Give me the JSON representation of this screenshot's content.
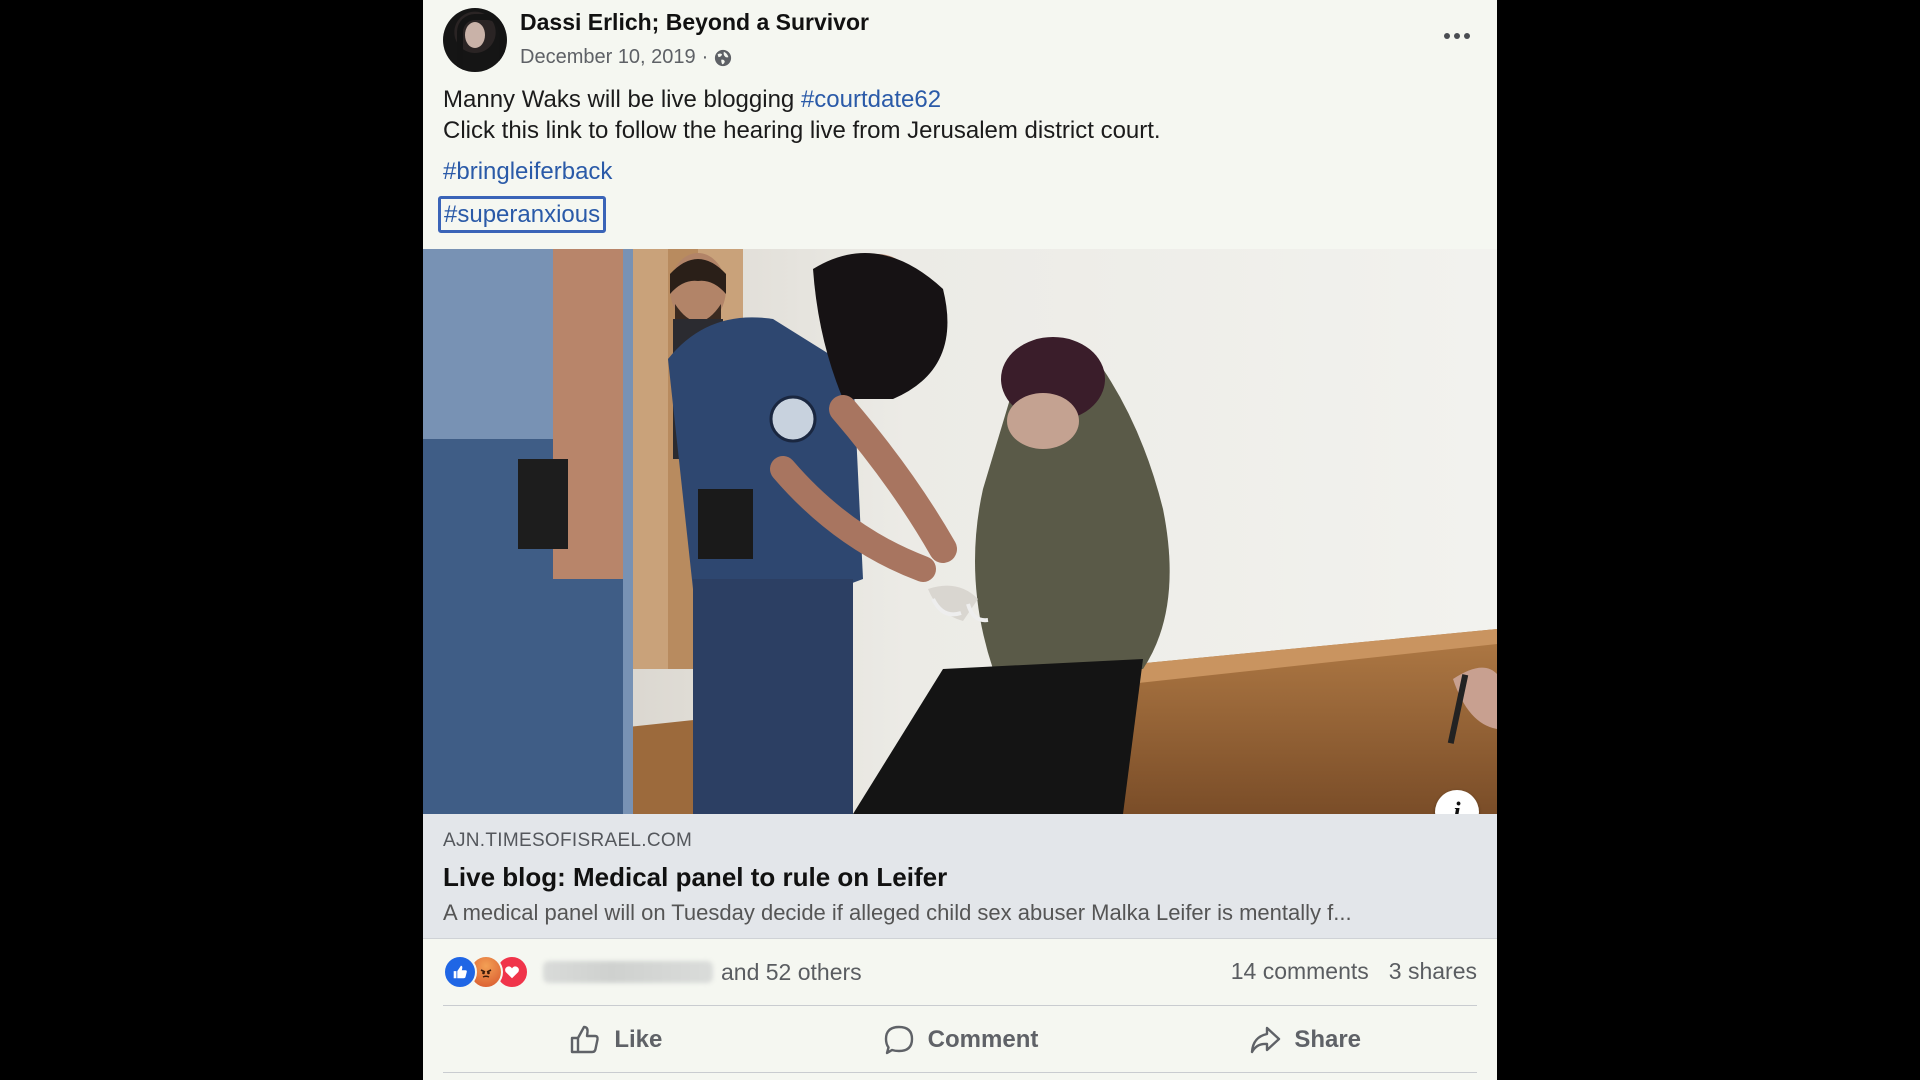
{
  "post": {
    "author": "Dassi Erlich; Beyond a Survivor",
    "date": "December 10, 2019",
    "date_separator": "·",
    "privacy_icon": "globe-icon",
    "text_line1_prefix": "Manny Waks will be live blogging ",
    "text_line1_tag": "#courtdate62",
    "text_line2": "Click this link to follow the hearing live from Jerusalem district court.",
    "tag1": "#bringleiferback",
    "tag2": "#superanxious"
  },
  "link": {
    "domain": "AJN.TIMESOFISRAEL.COM",
    "title": "Live blog: Medical panel to rule on Leifer",
    "description": "A medical panel will on Tuesday decide if alleged child sex abuser Malka Leifer is mentally f...",
    "info_label": "i"
  },
  "engagement": {
    "reaction_icons": [
      "like-icon",
      "angry-icon",
      "love-icon"
    ],
    "others": "and 52 others",
    "comments": "14 comments",
    "shares": "3 shares"
  },
  "actions": {
    "like": "Like",
    "comment": "Comment",
    "share": "Share"
  },
  "colors": {
    "link": "#2a5aa8",
    "like_blue": "#1f66e5",
    "love_red": "#f0344a"
  }
}
